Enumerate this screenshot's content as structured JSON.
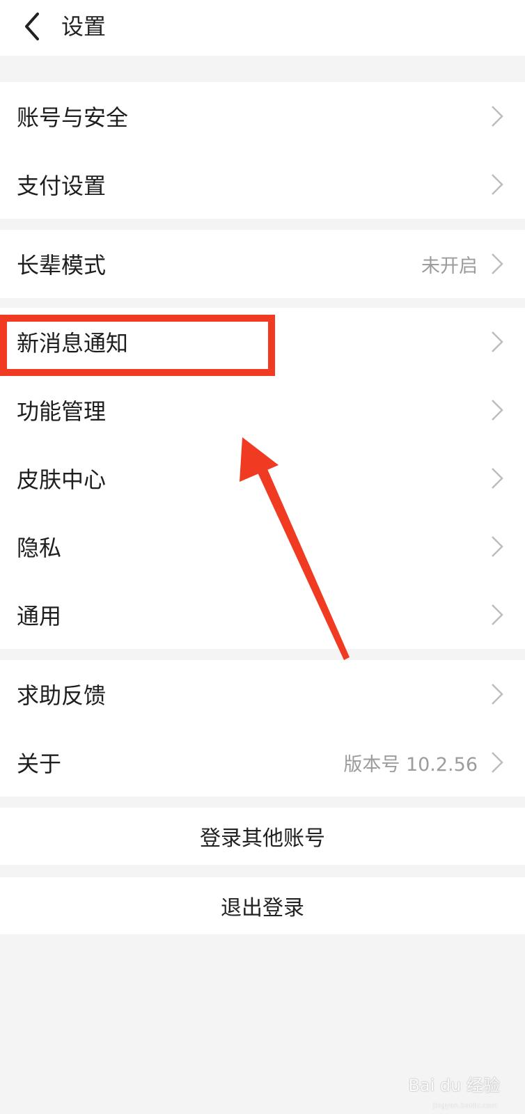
{
  "header": {
    "title": "设置",
    "back_icon": "chevron-left-icon"
  },
  "groups": [
    {
      "items": [
        {
          "label": "账号与安全",
          "value": ""
        },
        {
          "label": "支付设置",
          "value": ""
        }
      ]
    },
    {
      "items": [
        {
          "label": "长辈模式",
          "value": "未开启"
        }
      ]
    },
    {
      "items": [
        {
          "label": "新消息通知",
          "value": ""
        },
        {
          "label": "功能管理",
          "value": ""
        },
        {
          "label": "皮肤中心",
          "value": ""
        },
        {
          "label": "隐私",
          "value": ""
        },
        {
          "label": "通用",
          "value": ""
        }
      ]
    },
    {
      "items": [
        {
          "label": "求助反馈",
          "value": ""
        },
        {
          "label": "关于",
          "value": "版本号 10.2.56"
        }
      ]
    }
  ],
  "actions": {
    "login_other": "登录其他账号",
    "logout": "退出登录"
  },
  "annotation": {
    "highlight_color": "#f03a22",
    "icon": "arrow-up-left-icon"
  },
  "watermark": {
    "brand": "Bai du 经验",
    "url": "jingyan.baidu.com"
  },
  "colors": {
    "background": "#f4f4f4",
    "row_background": "#ffffff",
    "chevron": "#bdbdbd",
    "secondary_text": "#9c9c9c"
  }
}
